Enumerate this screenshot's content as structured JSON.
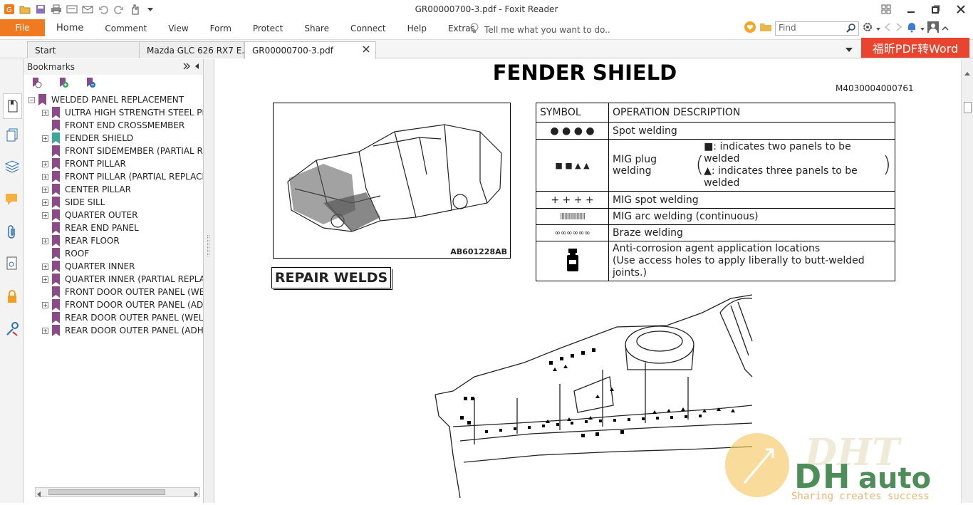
{
  "window": {
    "title": "GR00000700-3.pdf - Foxit Reader"
  },
  "ribbon": {
    "file_label": "File",
    "menus": [
      "Home",
      "Comment",
      "View",
      "Form",
      "Protect",
      "Share",
      "Connect",
      "Help",
      "Extras"
    ],
    "tell_me": "Tell me what you want to do..",
    "find_placeholder": "Find"
  },
  "tabs": {
    "start": "Start",
    "doc1": "Mazda GLC 626 RX7 E...",
    "doc2": "GR00000700-3.pdf"
  },
  "converter_label": "福昕PDF转Word",
  "bookmarks": {
    "header": "Bookmarks",
    "root": "WELDED PANEL REPLACEMENT",
    "items": [
      {
        "label": "ULTRA HIGH STRENGTH STEEL PL",
        "expandable": true
      },
      {
        "label": "FRONT END CROSSMEMBER",
        "expandable": false
      },
      {
        "label": "FENDER SHIELD",
        "expandable": true,
        "selected": true
      },
      {
        "label": "FRONT SIDEMEMBER (PARTIAL RE",
        "expandable": false
      },
      {
        "label": "FRONT PILLAR",
        "expandable": true
      },
      {
        "label": "FRONT PILLAR (PARTIAL REPLACE",
        "expandable": true
      },
      {
        "label": "CENTER PILLAR",
        "expandable": true
      },
      {
        "label": "SIDE SILL",
        "expandable": true
      },
      {
        "label": "QUARTER OUTER",
        "expandable": true
      },
      {
        "label": "REAR END PANEL",
        "expandable": false
      },
      {
        "label": "REAR FLOOR",
        "expandable": true
      },
      {
        "label": "ROOF",
        "expandable": false
      },
      {
        "label": "QUARTER INNER",
        "expandable": true
      },
      {
        "label": "QUARTER INNER (PARTIAL REPLA",
        "expandable": true
      },
      {
        "label": "FRONT DOOR OUTER PANEL (WEI",
        "expandable": false
      },
      {
        "label": "FRONT DOOR OUTER PANEL (ADH",
        "expandable": true
      },
      {
        "label": "REAR DOOR OUTER PANEL (WELD",
        "expandable": false
      },
      {
        "label": "REAR DOOR OUTER PANEL (ADHE",
        "expandable": true
      }
    ]
  },
  "document": {
    "title": "FENDER SHIELD",
    "doc_id": "M4030004000761",
    "figure_caption": "AB601228AB",
    "table": {
      "header_symbol": "SYMBOL",
      "header_desc": "OPERATION DESCRIPTION",
      "rows": [
        {
          "symbol": "●  ●  ●  ●",
          "desc": "Spot welding"
        },
        {
          "symbol": "■  ■  ▲  ▲",
          "desc": "MIG plug welding",
          "note1": "■: indicates two panels to be welded",
          "note2": "▲: indicates three panels to be welded"
        },
        {
          "symbol": "+ + + +",
          "desc": "MIG spot welding"
        },
        {
          "symbol": "|||||||||||||||||",
          "desc": "MIG arc welding (continuous)"
        },
        {
          "symbol": "∞∞∞∞∞∞",
          "desc": "Braze welding"
        },
        {
          "symbol": "",
          "desc": "Anti-corrosion agent application locations",
          "desc2": "(Use access holes to apply liberally to butt-welded joints.)"
        }
      ]
    },
    "section": "REPAIR WELDS"
  },
  "watermark": {
    "brand": "DHTauto",
    "slogan": "Sharing creates success"
  },
  "colors": {
    "accent": "#f07a22",
    "converter": "#e8442e",
    "bookmark_flag": "#8b4b8b",
    "bookmark_selected": "#3aa89a"
  }
}
